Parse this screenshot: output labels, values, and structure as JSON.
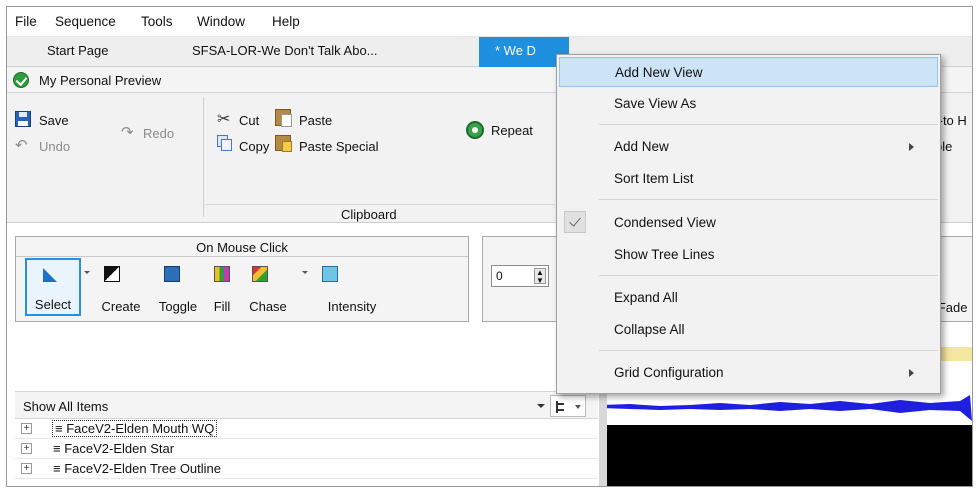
{
  "menubar": {
    "items": [
      "File",
      "Sequence",
      "Tools",
      "Window",
      "Help"
    ]
  },
  "tabs": {
    "start": "Start Page",
    "doc1": "SFSA-LOR-We Don't Talk Abo...",
    "active": "* We D"
  },
  "preview": {
    "label": "My Personal Preview"
  },
  "ribbon": {
    "save": "Save",
    "undo": "Undo",
    "redo": "Redo",
    "cut": "Cut",
    "copy": "Copy",
    "paste": "Paste",
    "paste_special": "Paste Special",
    "repeat": "Repeat",
    "clipboard_group": "Clipboard",
    "partial_right_1": "t-to H",
    "partial_right_2": "ble"
  },
  "mouse_click": {
    "title": "On Mouse Click",
    "tools": [
      "Select",
      "Create",
      "Toggle",
      "Fill",
      "Chase",
      "Intensity"
    ]
  },
  "spinner": {
    "value": "0"
  },
  "right_fragment": {
    "fade": "g Fade"
  },
  "item_list": {
    "filter": "Show All Items",
    "rows": [
      {
        "expander": "+",
        "label": "≡ FaceV2-Elden Mouth WQ"
      },
      {
        "expander": "+",
        "label": "≡ FaceV2-Elden Star"
      },
      {
        "expander": "+",
        "label": "≡ FaceV2-Elden Tree Outline"
      }
    ]
  },
  "context_menu": {
    "items": [
      {
        "label": "Add New View",
        "highlighted": true
      },
      {
        "label": "Save View As"
      },
      {
        "label": "Add New",
        "submenu": true
      },
      {
        "label": "Sort Item List"
      },
      {
        "label": "Condensed View",
        "checked": true
      },
      {
        "label": "Show Tree Lines"
      },
      {
        "label": "Expand All"
      },
      {
        "label": "Collapse All"
      },
      {
        "label": "Grid Configuration",
        "submenu": true
      }
    ]
  },
  "colors": {
    "active_tab": "#1f8fe0",
    "menu_highlight": "#cde4f7",
    "waveform": "#1f1fe0"
  }
}
